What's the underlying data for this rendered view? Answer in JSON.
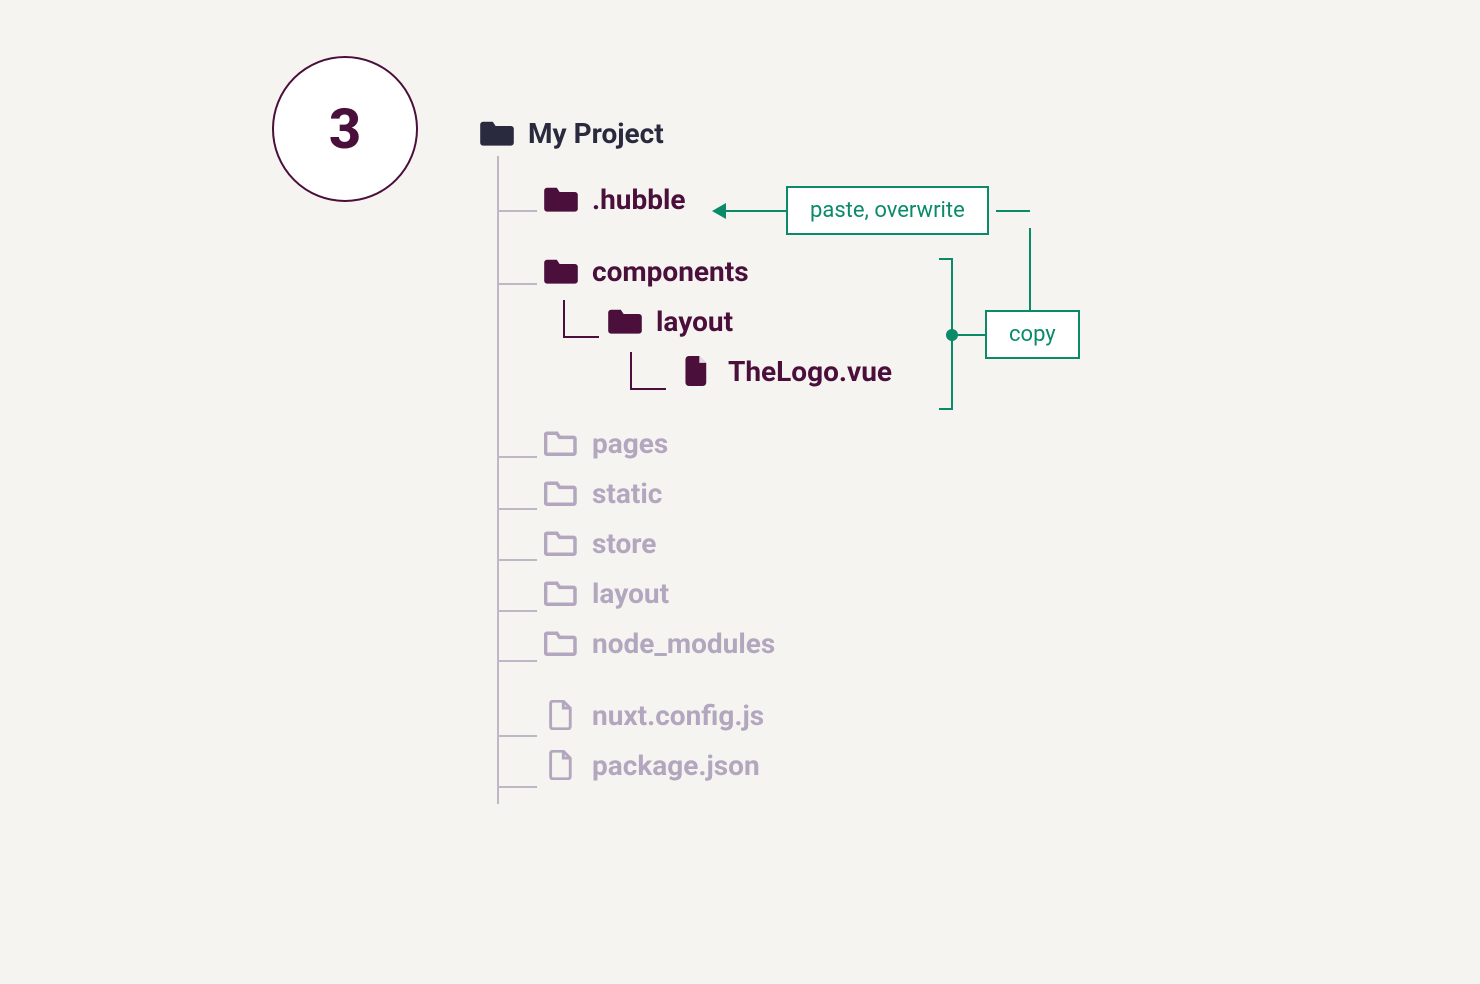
{
  "step_number": "3",
  "tree": {
    "root": "My Project",
    "hubble": ".hubble",
    "components": "components",
    "layout_sub": "layout",
    "thelogo": "TheLogo.vue",
    "pages": "pages",
    "static": "static",
    "store": "store",
    "layout": "layout",
    "node_modules": "node_modules",
    "nuxt_config": "nuxt.config.js",
    "package_json": "package.json"
  },
  "callouts": {
    "paste": "paste, overwrite",
    "copy": "copy"
  },
  "colors": {
    "accent": "#4a0f3a",
    "muted": "#b3a7bf",
    "green": "#0b8a6a",
    "dark_folder": "#2a2a3e"
  }
}
